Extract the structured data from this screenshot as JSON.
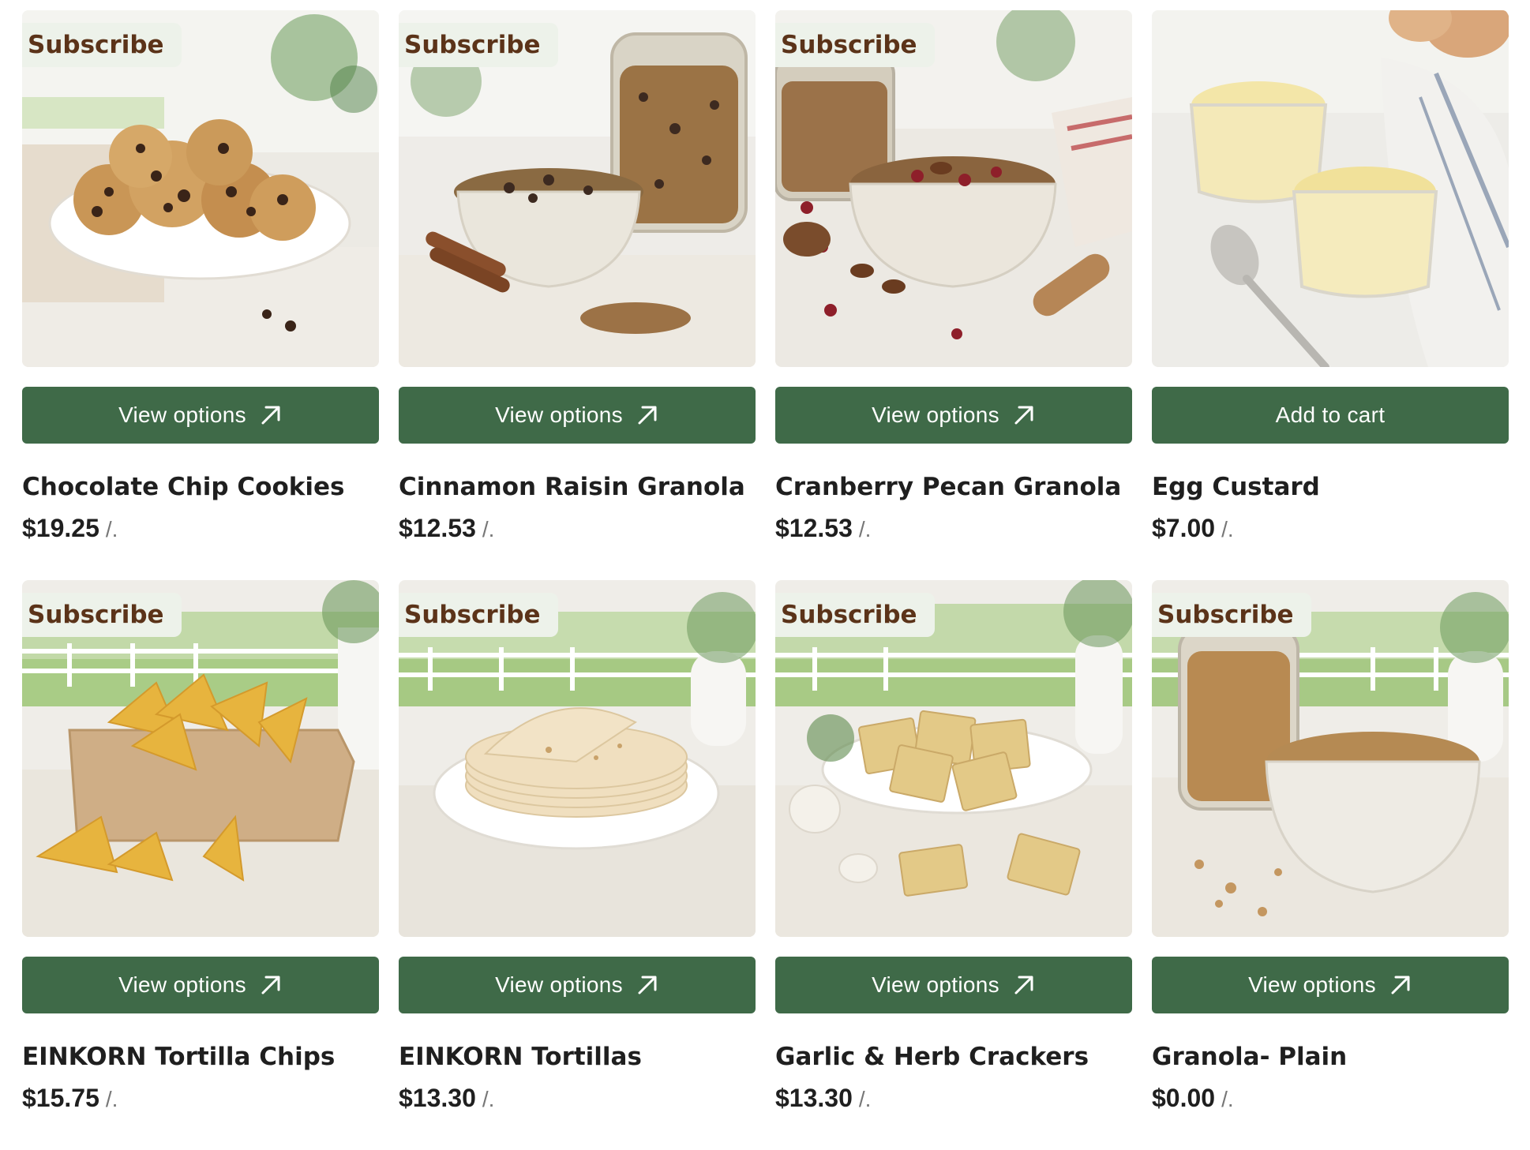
{
  "products": [
    {
      "badge": "Subscribe",
      "button": "View options",
      "button_icon": "arrow-up-right-icon",
      "name": "Chocolate Chip Cookies",
      "price": "$19.25",
      "unit": "/.",
      "image": "cookies-image"
    },
    {
      "badge": "Subscribe",
      "button": "View options",
      "button_icon": "arrow-up-right-icon",
      "name": "Cinnamon Raisin Granola",
      "price": "$12.53",
      "unit": "/.",
      "image": "granola-raisin-image"
    },
    {
      "badge": "Subscribe",
      "button": "View options",
      "button_icon": "arrow-up-right-icon",
      "name": "Cranberry Pecan Granola",
      "price": "$12.53",
      "unit": "/.",
      "image": "granola-cranberry-image"
    },
    {
      "badge": "",
      "button": "Add to cart",
      "button_icon": "",
      "name": "Egg Custard",
      "price": "$7.00",
      "unit": "/.",
      "image": "custard-image"
    },
    {
      "badge": "Subscribe",
      "button": "View options",
      "button_icon": "arrow-up-right-icon",
      "name": "EINKORN Tortilla Chips",
      "price": "$15.75",
      "unit": "/.",
      "image": "tortilla-chips-image"
    },
    {
      "badge": "Subscribe",
      "button": "View options",
      "button_icon": "arrow-up-right-icon",
      "name": "EINKORN Tortillas",
      "price": "$13.30",
      "unit": "/.",
      "image": "tortillas-image"
    },
    {
      "badge": "Subscribe",
      "button": "View options",
      "button_icon": "arrow-up-right-icon",
      "name": "Garlic & Herb Crackers",
      "price": "$13.30",
      "unit": "/.",
      "image": "crackers-image"
    },
    {
      "badge": "Subscribe",
      "button": "View options",
      "button_icon": "arrow-up-right-icon",
      "name": "Granola- Plain",
      "price": "$0.00",
      "unit": "/.",
      "image": "granola-plain-image"
    }
  ],
  "colors": {
    "button_bg": "#3f6a48",
    "badge_bg": "#edf2ea",
    "badge_text": "#5b3319",
    "text": "#1f1f1f"
  }
}
